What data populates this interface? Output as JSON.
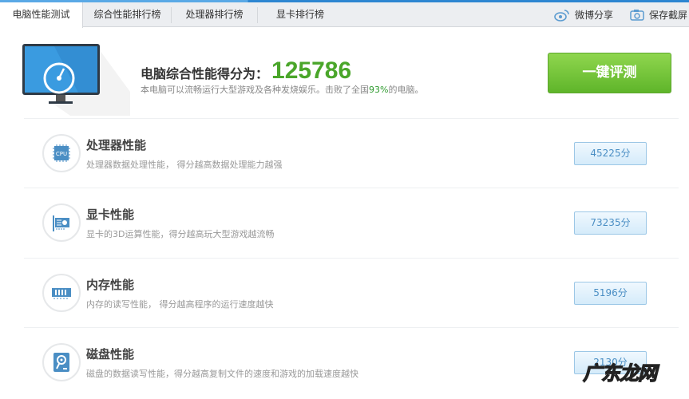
{
  "tabs": [
    {
      "label": "电脑性能测试",
      "active": true
    },
    {
      "label": "综合性能排行榜"
    },
    {
      "label": "处理器排行榜"
    },
    {
      "label": "显卡排行榜"
    }
  ],
  "toolbar": {
    "weibo_share": "微博分享",
    "save_screenshot": "保存截屏",
    "weibo_icon": "weibo-icon",
    "camera_icon": "camera-icon"
  },
  "summary": {
    "title": "电脑综合性能得分为：",
    "score": "125786",
    "desc_prefix": "本电脑可以流畅运行大型游戏及各种发烧娱乐。击败了全国",
    "percent": "93%",
    "desc_suffix": "的电脑。",
    "button": "一键评测"
  },
  "rows": [
    {
      "icon": "cpu-icon",
      "title": "处理器性能",
      "desc": "处理器数据处理性能， 得分越高数据处理能力越强",
      "score": "45225分"
    },
    {
      "icon": "graphics-card-icon",
      "title": "显卡性能",
      "desc": "显卡的3D运算性能，得分越高玩大型游戏越流畅",
      "score": "73235分"
    },
    {
      "icon": "memory-icon",
      "title": "内存性能",
      "desc": "内存的读写性能， 得分越高程序的运行速度越快",
      "score": "5196分"
    },
    {
      "icon": "disk-icon",
      "title": "磁盘性能",
      "desc": "磁盘的数据读写性能，得分越高复制文件的速度和游戏的加载速度越快",
      "score": "2130分"
    }
  ],
  "colors": {
    "accent_green": "#4aa62a",
    "accent_blue": "#2d86d1",
    "icon_blue": "#4a8ec4"
  },
  "watermark": "广东龙网"
}
